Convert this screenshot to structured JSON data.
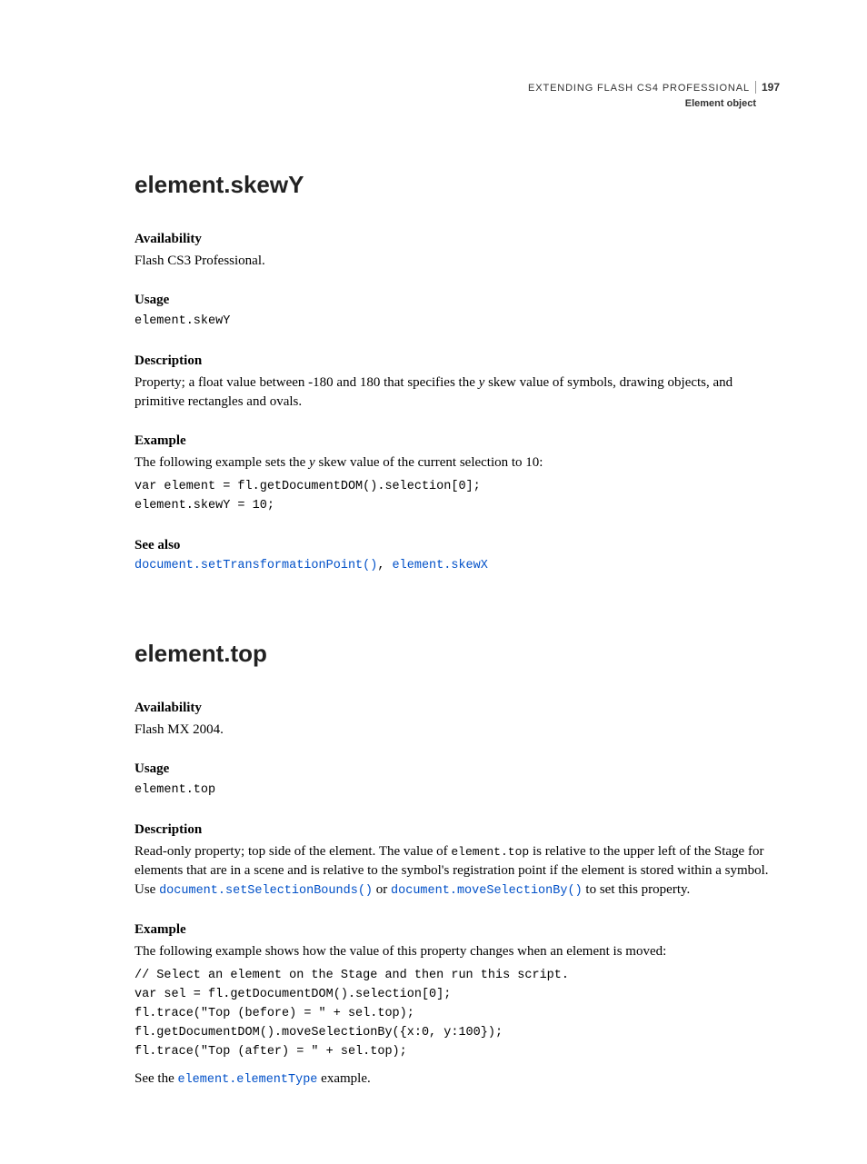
{
  "header": {
    "book": "EXTENDING FLASH CS4 PROFESSIONAL",
    "chapter": "Element object",
    "page": "197"
  },
  "entries": [
    {
      "title": "element.skewY",
      "availability_label": "Availability",
      "availability_text": "Flash CS3 Professional.",
      "usage_label": "Usage",
      "usage_code": "element.skewY",
      "description_label": "Description",
      "description_pre": "Property; a float value between -180 and 180 that specifies the ",
      "description_ital": "y",
      "description_post": " skew value of symbols, drawing objects, and primitive rectangles and ovals.",
      "example_label": "Example",
      "example_intro_pre": "The following example sets the ",
      "example_intro_ital": "y",
      "example_intro_post": " skew value of the current selection to 10:",
      "example_code": "var element = fl.getDocumentDOM().selection[0];\nelement.skewY = 10;",
      "seealso_label": "See also",
      "seealso_link1": "document.setTransformationPoint()",
      "seealso_sep": ", ",
      "seealso_link2": "element.skewX"
    },
    {
      "title": "element.top",
      "availability_label": "Availability",
      "availability_text": "Flash MX 2004.",
      "usage_label": "Usage",
      "usage_code": "element.top",
      "description_label": "Description",
      "description_pre": "Read-only property; top side of the element. The value of ",
      "description_code1": "element.top",
      "description_mid": " is relative to the upper left of the Stage for elements that are in a scene and is relative to the symbol's registration point if the element is stored within a symbol. Use ",
      "description_link1": "document.setSelectionBounds()",
      "description_or": " or ",
      "description_link2": "document.moveSelectionBy()",
      "description_post": " to set this property.",
      "example_label": "Example",
      "example_intro": "The following example shows how the value of this property changes when an element is moved:",
      "example_code": "// Select an element on the Stage and then run this script.\nvar sel = fl.getDocumentDOM().selection[0];\nfl.trace(\"Top (before) = \" + sel.top);\nfl.getDocumentDOM().moveSelectionBy({x:0, y:100});\nfl.trace(\"Top (after) = \" + sel.top);",
      "see_pre": "See the ",
      "see_link": "element.elementType",
      "see_post": " example."
    }
  ]
}
